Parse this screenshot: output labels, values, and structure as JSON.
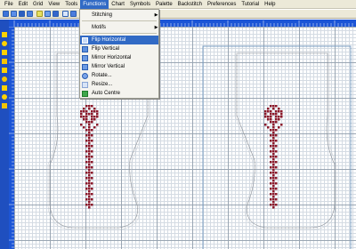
{
  "menubar": {
    "items": [
      "File",
      "Edit",
      "Grid",
      "View",
      "Tools",
      "Functions",
      "Chart",
      "Symbols",
      "Palette",
      "Backstitch",
      "Preferences",
      "Tutorial",
      "Help"
    ]
  },
  "functions_menu": {
    "items": [
      {
        "label": "Stitching",
        "has_submenu": true
      },
      {
        "label": "Motifs",
        "has_submenu": true
      },
      {
        "label": "Flip Horizontal",
        "highlighted": true
      },
      {
        "label": "Flip Vertical"
      },
      {
        "label": "Mirror Horizontal"
      },
      {
        "label": "Mirror Vertical"
      },
      {
        "label": "Rotate..."
      },
      {
        "label": "Resize..."
      },
      {
        "label": "Auto Centre"
      }
    ]
  },
  "colors": {
    "ruler": "#1c55d6",
    "highlight": "#316ac5",
    "stitch": "#8b1a2b"
  }
}
